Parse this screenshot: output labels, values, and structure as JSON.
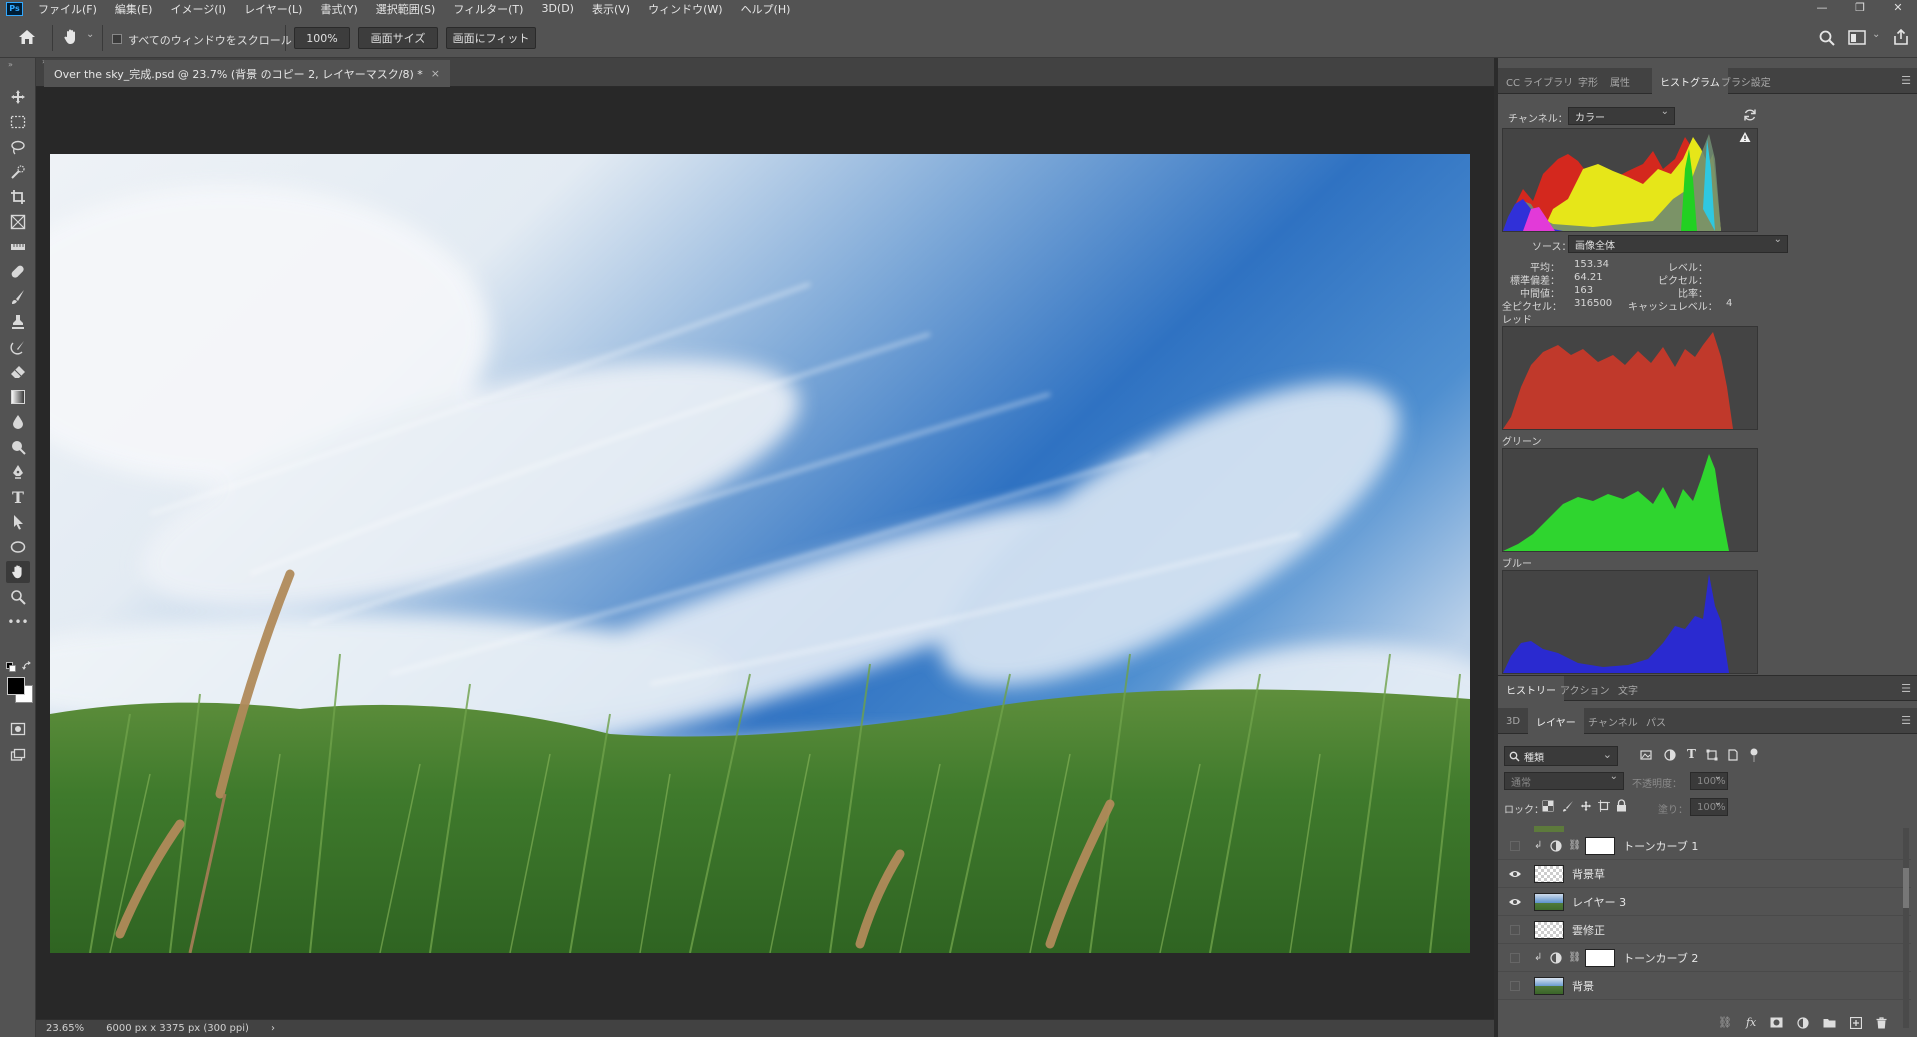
{
  "app": {
    "logo": "Ps",
    "accent": "#31a8ff"
  },
  "menu": {
    "items": [
      "ファイル(F)",
      "編集(E)",
      "イメージ(I)",
      "レイヤー(L)",
      "書式(Y)",
      "選択範囲(S)",
      "フィルター(T)",
      "3D(D)",
      "表示(V)",
      "ウィンドウ(W)",
      "ヘルプ(H)"
    ]
  },
  "window_controls": {
    "minimize": "—",
    "restore": "❐",
    "close": "✕"
  },
  "options": {
    "scroll_all_label": "すべてのウィンドウをスクロール",
    "zoom_value": "100%",
    "fit_screen_label": "画面サイズ",
    "fill_screen_label": "画面にフィット"
  },
  "document": {
    "tab_title": "Over the sky_完成.psd @ 23.7% (背景 のコピー 2, レイヤーマスク/8) *",
    "close": "×"
  },
  "status": {
    "zoom": "23.65%",
    "doc_info": "6000 px x 3375 px (300 ppi)",
    "arrow": "›"
  },
  "top_panel": {
    "tabs": [
      "CC ライブラリ",
      "字形",
      "属性",
      "ヒストグラム",
      "ブラシ設定"
    ],
    "active_tab": "ヒストグラム",
    "channel_label": "チャンネル：",
    "channel_value": "カラー",
    "source_label": "ソース：",
    "source_value": "画像全体",
    "stats": {
      "mean_label": "平均：",
      "mean_value": "153.34",
      "stddev_label": "標準偏差：",
      "stddev_value": "64.21",
      "median_label": "中間値：",
      "median_value": "163",
      "pixels_label": "全ピクセル：",
      "pixels_value": "316500",
      "level_label": "レベル：",
      "count_label": "ピクセル：",
      "percentile_label": "比率：",
      "cache_label": "キャッシュレベル：",
      "cache_value": "4"
    },
    "red_label": "レッド",
    "green_label": "グリーン",
    "blue_label": "ブルー",
    "colors": {
      "red": "#c0392b",
      "green": "#2fd52f",
      "blue": "#2a2ad0"
    }
  },
  "history_panel": {
    "tabs": [
      "ヒストリー",
      "アクション",
      "文字"
    ]
  },
  "layers_panel": {
    "tabs": [
      "3D",
      "レイヤー",
      "チャンネル",
      "パス"
    ],
    "active_tab": "レイヤー",
    "filter_value": "種類",
    "blend_mode": "通常",
    "opacity_label": "不透明度：",
    "opacity_value": "100%",
    "lock_label": "ロック：",
    "fill_label": "塗り：",
    "fill_value": "100%",
    "layers": [
      {
        "name": "トーンカーブ 1",
        "visible": false,
        "type": "adjust"
      },
      {
        "name": "背景草",
        "visible": true,
        "type": "grass"
      },
      {
        "name": "レイヤー 3",
        "visible": true,
        "type": "sky"
      },
      {
        "name": "雲修正",
        "visible": false,
        "type": "empty"
      },
      {
        "name": "トーンカーブ 2",
        "visible": false,
        "type": "adjust"
      },
      {
        "name": "背景",
        "visible": false,
        "type": "photo"
      }
    ]
  }
}
